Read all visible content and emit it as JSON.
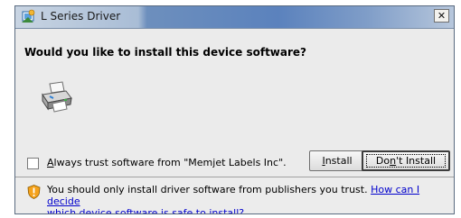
{
  "window": {
    "title": "L Series Driver",
    "close_glyph": "✕"
  },
  "dialog": {
    "heading": "Would you like to install this device software?",
    "device_icon": "printer-icon"
  },
  "trust_option": {
    "checked": false,
    "label_accel": "A",
    "label_rest": "lways trust software from \"Memjet Labels Inc\"."
  },
  "buttons": {
    "install_accel": "I",
    "install_rest": "nstall",
    "dont_install_pre": "Do",
    "dont_install_accel": "n",
    "dont_install_post": "'t Install"
  },
  "footer": {
    "icon": "warning-shield-icon",
    "text": "You should only install driver software from publishers you trust. ",
    "link_first": "How can I decide",
    "link_second": "which device software is safe to install?"
  },
  "colors": {
    "link": "#0000cc",
    "dialog_background": "#ebebeb"
  }
}
